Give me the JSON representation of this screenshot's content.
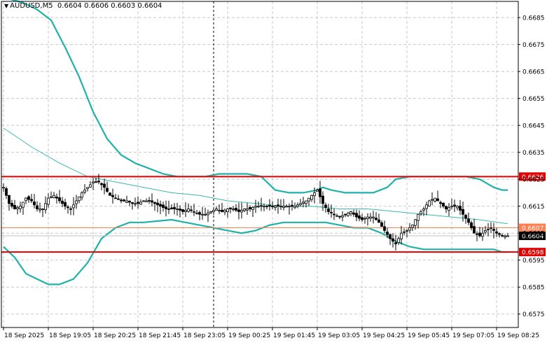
{
  "header": {
    "symbol": "AUDUSD,M5",
    "ohlc": "0.6604 0.6606 0.6603 0.6604"
  },
  "colors": {
    "band": "#1fb2aa",
    "ma": "#3ab7b0",
    "resistance": "#e00000",
    "current_line": "#ff7f50",
    "grid": "#c8c8c8",
    "candle": "#000000"
  },
  "chart_data": {
    "type": "line",
    "instrument": "AUDUSD",
    "timeframe": "M5",
    "ylim": [
      0.657,
      0.6691
    ],
    "xlim": [
      0,
      196
    ],
    "y_ticks": [
      "0.6685",
      "0.6675",
      "0.6665",
      "0.6655",
      "0.6645",
      "0.6635",
      "0.6625",
      "0.6615",
      "0.6605",
      "0.6595",
      "0.6585",
      "0.6575"
    ],
    "x_tick_positions": [
      0,
      16,
      32,
      48,
      64,
      80,
      96,
      112,
      128,
      144,
      160,
      176
    ],
    "x_tick_labels": [
      "18 Sep 2025",
      "18 Sep 19:05",
      "18 Sep 20:25",
      "18 Sep 21:45",
      "18 Sep 23:05",
      "19 Sep 00:25",
      "19 Sep 01:45",
      "19 Sep 03:05",
      "19 Sep 04:25",
      "19 Sep 05:45",
      "19 Sep 07:05",
      "19 Sep 08:25"
    ],
    "vertical_marker_x": 75,
    "horizontal_levels": [
      {
        "value": 0.6626,
        "label": "0.6626",
        "color": "#e00000",
        "width": 2
      },
      {
        "value": 0.6607,
        "label": "0.6607",
        "color": "#ff7f50",
        "width": 1
      },
      {
        "value": 0.6598,
        "label": "0.6598",
        "color": "#e00000",
        "width": 2
      }
    ],
    "current_price": {
      "value": 0.6604,
      "label": "0.6604"
    },
    "series": [
      {
        "role": "upper-band",
        "points": [
          [
            0,
            0.66925
          ],
          [
            7,
            0.66905
          ],
          [
            12,
            0.6688
          ],
          [
            17,
            0.6684
          ],
          [
            22,
            0.6674
          ],
          [
            27,
            0.6663
          ],
          [
            32,
            0.665
          ],
          [
            37,
            0.664
          ],
          [
            42,
            0.6634
          ],
          [
            47,
            0.6631
          ],
          [
            52,
            0.6629
          ],
          [
            57,
            0.6627
          ],
          [
            62,
            0.6626
          ],
          [
            67,
            0.6626
          ],
          [
            72,
            0.6626
          ],
          [
            77,
            0.6627
          ],
          [
            82,
            0.6627
          ],
          [
            87,
            0.6627
          ],
          [
            92,
            0.6626
          ],
          [
            97,
            0.6621
          ],
          [
            102,
            0.662
          ],
          [
            107,
            0.662
          ],
          [
            112,
            0.6621
          ],
          [
            114,
            0.6622
          ],
          [
            117,
            0.6621
          ],
          [
            122,
            0.662
          ],
          [
            127,
            0.662
          ],
          [
            132,
            0.662
          ],
          [
            137,
            0.6622
          ],
          [
            140,
            0.6625
          ],
          [
            145,
            0.6626
          ],
          [
            150,
            0.6626
          ],
          [
            155,
            0.6626
          ],
          [
            160,
            0.6626
          ],
          [
            165,
            0.6626
          ],
          [
            170,
            0.6625
          ],
          [
            175,
            0.6622
          ],
          [
            178,
            0.6621
          ],
          [
            180,
            0.6621
          ]
        ]
      },
      {
        "role": "middle-ma",
        "points": [
          [
            0,
            0.6644
          ],
          [
            10,
            0.6637
          ],
          [
            20,
            0.6631
          ],
          [
            30,
            0.6626
          ],
          [
            40,
            0.6624
          ],
          [
            50,
            0.6622
          ],
          [
            60,
            0.662
          ],
          [
            70,
            0.6619
          ],
          [
            80,
            0.6617
          ],
          [
            90,
            0.6616
          ],
          [
            100,
            0.6615
          ],
          [
            110,
            0.6615
          ],
          [
            120,
            0.6614
          ],
          [
            130,
            0.6614
          ],
          [
            140,
            0.6613
          ],
          [
            150,
            0.6612
          ],
          [
            160,
            0.6611
          ],
          [
            170,
            0.661
          ],
          [
            180,
            0.66085
          ]
        ]
      },
      {
        "role": "lower-band",
        "points": [
          [
            0,
            0.66
          ],
          [
            4,
            0.6596
          ],
          [
            8,
            0.659
          ],
          [
            12,
            0.6588
          ],
          [
            16,
            0.6586
          ],
          [
            20,
            0.6586
          ],
          [
            25,
            0.6588
          ],
          [
            30,
            0.6594
          ],
          [
            35,
            0.6603
          ],
          [
            40,
            0.6607
          ],
          [
            45,
            0.6609
          ],
          [
            50,
            0.6609
          ],
          [
            55,
            0.66095
          ],
          [
            60,
            0.661
          ],
          [
            65,
            0.6609
          ],
          [
            70,
            0.6608
          ],
          [
            75,
            0.6607
          ],
          [
            80,
            0.6606
          ],
          [
            85,
            0.6605
          ],
          [
            90,
            0.6606
          ],
          [
            95,
            0.6608
          ],
          [
            100,
            0.6609
          ],
          [
            105,
            0.6609
          ],
          [
            110,
            0.6609
          ],
          [
            115,
            0.6609
          ],
          [
            120,
            0.6608
          ],
          [
            125,
            0.6607
          ],
          [
            130,
            0.6607
          ],
          [
            135,
            0.6605
          ],
          [
            140,
            0.6602
          ],
          [
            145,
            0.66
          ],
          [
            150,
            0.6599
          ],
          [
            155,
            0.6599
          ],
          [
            160,
            0.6599
          ],
          [
            165,
            0.6599
          ],
          [
            170,
            0.6599
          ],
          [
            175,
            0.6599
          ],
          [
            178,
            0.6598
          ],
          [
            180,
            0.6598
          ]
        ]
      },
      {
        "role": "price",
        "points": [
          [
            0,
            0.6622
          ],
          [
            2,
            0.6616
          ],
          [
            4,
            0.6614
          ],
          [
            6,
            0.6615
          ],
          [
            8,
            0.6618
          ],
          [
            10,
            0.6617
          ],
          [
            12,
            0.6614
          ],
          [
            14,
            0.6614
          ],
          [
            16,
            0.6618
          ],
          [
            18,
            0.6619
          ],
          [
            20,
            0.6617
          ],
          [
            22,
            0.6615
          ],
          [
            24,
            0.6614
          ],
          [
            26,
            0.6617
          ],
          [
            28,
            0.662
          ],
          [
            30,
            0.6622
          ],
          [
            32,
            0.6624
          ],
          [
            34,
            0.6624
          ],
          [
            36,
            0.6622
          ],
          [
            38,
            0.6619
          ],
          [
            40,
            0.6618
          ],
          [
            42,
            0.6617
          ],
          [
            44,
            0.6617
          ],
          [
            46,
            0.6616
          ],
          [
            48,
            0.6616
          ],
          [
            50,
            0.6617
          ],
          [
            52,
            0.6617
          ],
          [
            54,
            0.6616
          ],
          [
            56,
            0.6615
          ],
          [
            58,
            0.6614
          ],
          [
            60,
            0.6614
          ],
          [
            62,
            0.6614
          ],
          [
            64,
            0.6613
          ],
          [
            66,
            0.6614
          ],
          [
            68,
            0.6613
          ],
          [
            70,
            0.6612
          ],
          [
            72,
            0.6612
          ],
          [
            74,
            0.6613
          ],
          [
            76,
            0.6614
          ],
          [
            78,
            0.6613
          ],
          [
            80,
            0.6614
          ],
          [
            82,
            0.6614
          ],
          [
            84,
            0.6613
          ],
          [
            86,
            0.6614
          ],
          [
            88,
            0.6614
          ],
          [
            90,
            0.6615
          ],
          [
            92,
            0.6615
          ],
          [
            94,
            0.6615
          ],
          [
            96,
            0.6615
          ],
          [
            98,
            0.6615
          ],
          [
            100,
            0.6615
          ],
          [
            102,
            0.6615
          ],
          [
            104,
            0.6615
          ],
          [
            106,
            0.6616
          ],
          [
            108,
            0.6617
          ],
          [
            110,
            0.6619
          ],
          [
            112,
            0.6621
          ],
          [
            114,
            0.6616
          ],
          [
            116,
            0.6613
          ],
          [
            118,
            0.6612
          ],
          [
            120,
            0.6611
          ],
          [
            122,
            0.6612
          ],
          [
            124,
            0.6613
          ],
          [
            126,
            0.6611
          ],
          [
            128,
            0.661
          ],
          [
            130,
            0.6611
          ],
          [
            132,
            0.6611
          ],
          [
            134,
            0.6609
          ],
          [
            136,
            0.6606
          ],
          [
            138,
            0.6603
          ],
          [
            140,
            0.6601
          ],
          [
            142,
            0.6605
          ],
          [
            144,
            0.6606
          ],
          [
            146,
            0.6608
          ],
          [
            148,
            0.6612
          ],
          [
            150,
            0.6614
          ],
          [
            152,
            0.6617
          ],
          [
            154,
            0.6618
          ],
          [
            156,
            0.6616
          ],
          [
            158,
            0.6614
          ],
          [
            160,
            0.6615
          ],
          [
            162,
            0.6615
          ],
          [
            164,
            0.6612
          ],
          [
            166,
            0.6609
          ],
          [
            168,
            0.6605
          ],
          [
            170,
            0.6604
          ],
          [
            172,
            0.6606
          ],
          [
            174,
            0.6607
          ],
          [
            176,
            0.6605
          ],
          [
            178,
            0.6604
          ],
          [
            180,
            0.6604
          ]
        ]
      }
    ]
  }
}
